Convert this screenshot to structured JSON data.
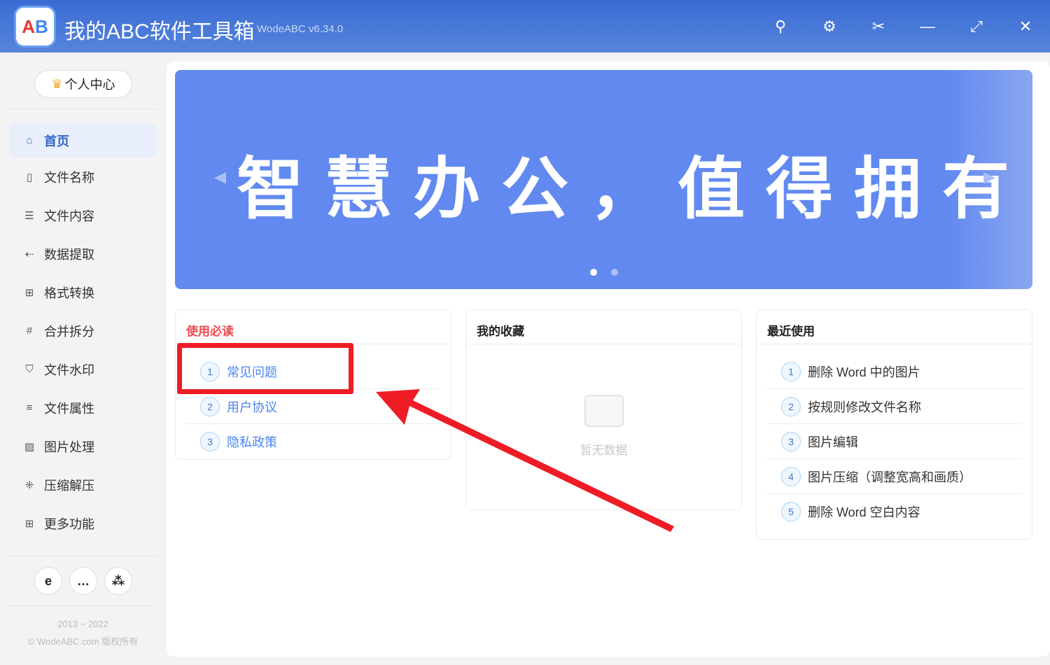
{
  "app": {
    "title": "我的ABC软件工具箱",
    "version": "WodeABC v6.34.0",
    "logo_text": "AB"
  },
  "titlebar_icons": [
    "search-icon",
    "settings-icon",
    "scissors-icon",
    "minimize-icon",
    "maximize-icon",
    "close-icon"
  ],
  "sidebar": {
    "profile_label": "个人中心",
    "items": [
      {
        "label": "首页",
        "icon": "⌂",
        "active": true
      },
      {
        "label": "文件名称",
        "icon": "▯"
      },
      {
        "label": "文件内容",
        "icon": "☰"
      },
      {
        "label": "数据提取",
        "icon": "⇠"
      },
      {
        "label": "格式转换",
        "icon": "⊞"
      },
      {
        "label": "合并拆分",
        "icon": "#"
      },
      {
        "label": "文件水印",
        "icon": "⛉"
      },
      {
        "label": "文件属性",
        "icon": "≡"
      },
      {
        "label": "图片处理",
        "icon": "▨"
      },
      {
        "label": "压缩解压",
        "icon": "⁜"
      },
      {
        "label": "更多功能",
        "icon": "⊞"
      }
    ],
    "copyright_years": "2013 ~ 2022",
    "copyright": "© WodeABC.com 版权所有"
  },
  "banner": {
    "slogan": "智慧办公，值得拥有",
    "slide_count": 2,
    "active_slide": 1
  },
  "cards": {
    "must_read": {
      "title": "使用必读",
      "items": [
        "常见问题",
        "用户协议",
        "隐私政策"
      ]
    },
    "favorites": {
      "title": "我的收藏",
      "empty": "暂无数据"
    },
    "recent": {
      "title": "最近使用",
      "items": [
        "删除 Word 中的图片",
        "按规则修改文件名称",
        "图片编辑",
        "图片压缩（调整宽高和画质）",
        "删除 Word 空白内容"
      ]
    }
  }
}
